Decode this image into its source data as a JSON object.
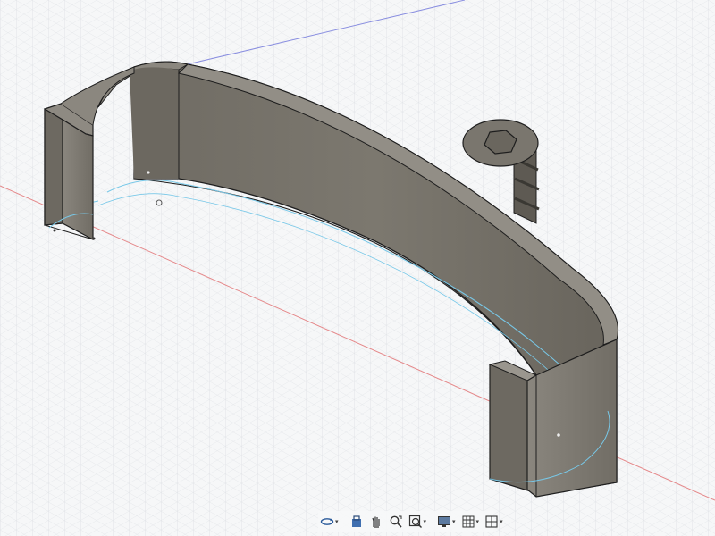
{
  "viewport": {
    "background_color": "#f6f7f8",
    "grid_color": "#d9dde2",
    "x_axis_color": "#e5888a",
    "y_axis_color": "#8a8fe0",
    "body_color": "#7a766e",
    "body_dark_color": "#5b5850",
    "edge_color": "#1e1e1e",
    "sketch_line_color": "#78c8e8"
  },
  "nav_bar": {
    "icons": [
      {
        "name": "orbit-icon",
        "has_dropdown": true
      },
      {
        "name": "look-at-icon",
        "has_dropdown": false
      },
      {
        "name": "pan-icon",
        "has_dropdown": false
      },
      {
        "name": "zoom-icon",
        "has_dropdown": false
      },
      {
        "name": "fit-icon",
        "has_dropdown": true
      },
      {
        "name": "display-settings-icon",
        "has_dropdown": true
      },
      {
        "name": "grid-settings-icon",
        "has_dropdown": true
      },
      {
        "name": "viewports-icon",
        "has_dropdown": true
      }
    ]
  }
}
